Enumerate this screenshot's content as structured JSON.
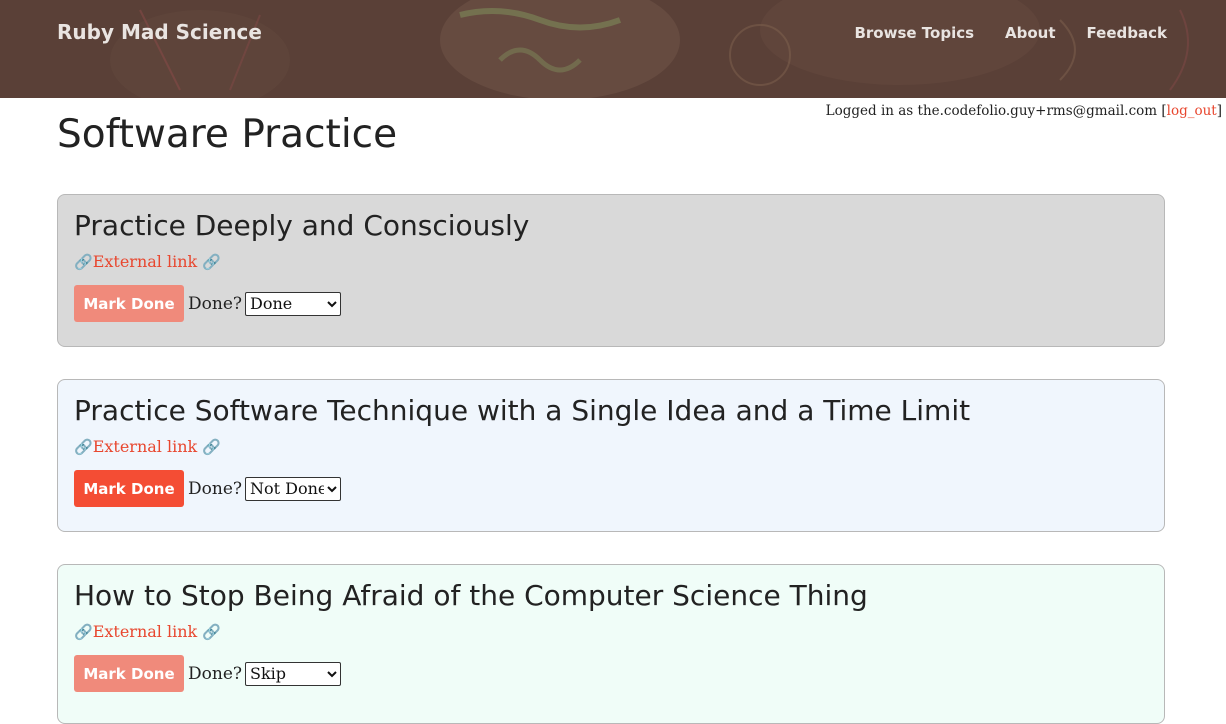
{
  "site": {
    "brand": "Ruby Mad Science",
    "nav": [
      "Browse Topics",
      "About",
      "Feedback"
    ]
  },
  "login": {
    "prefix": "Logged in as the.codefolio.guy+rms@gmail.com [",
    "logout_label": "log_out",
    "suffix": "]"
  },
  "page": {
    "title": "Software Practice"
  },
  "colors": {
    "accent": "#e8472f",
    "button_active": "#f44d34",
    "button_faded": "#f08a7b",
    "header_bg": "#5a4037"
  },
  "cards": [
    {
      "title": "Practice Deeply and Consciously",
      "link_label": "External link",
      "link_icon": "link-icon",
      "button_label": "Mark Done",
      "done_label": "Done?",
      "selected": "Done",
      "options": [
        "Not Done",
        "Done",
        "Skip"
      ],
      "background": "#d9d9d9",
      "button_color": "#f08a7b"
    },
    {
      "title": "Practice Software Technique with a Single Idea and a Time Limit",
      "link_label": "External link",
      "link_icon": "link-icon",
      "button_label": "Mark Done",
      "done_label": "Done?",
      "selected": "Not Done",
      "options": [
        "Not Done",
        "Done",
        "Skip"
      ],
      "background": "#f0f6fd",
      "button_color": "#f44d34"
    },
    {
      "title": "How to Stop Being Afraid of the Computer Science Thing",
      "link_label": "External link",
      "link_icon": "link-icon",
      "button_label": "Mark Done",
      "done_label": "Done?",
      "selected": "Skip",
      "options": [
        "Not Done",
        "Done",
        "Skip"
      ],
      "background": "#f0fdf8",
      "button_color": "#f08a7b"
    }
  ]
}
